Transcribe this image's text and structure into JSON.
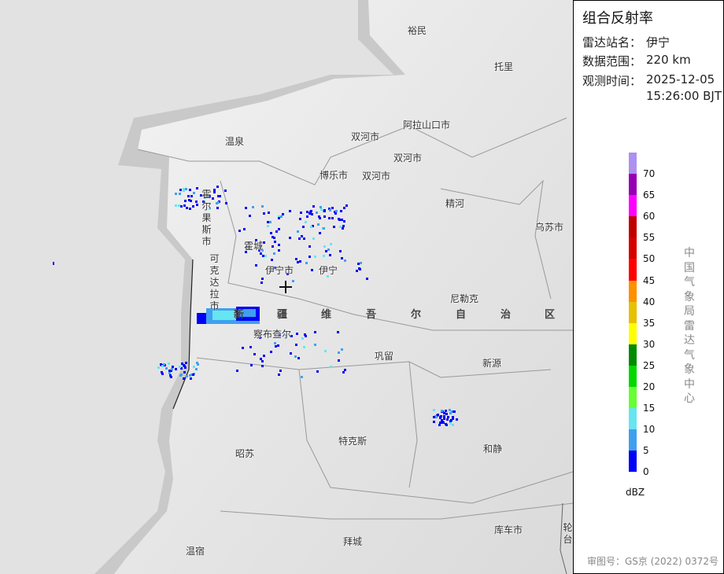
{
  "panel": {
    "title": "组合反射率",
    "station_label": "雷达站名：",
    "station": "伊宁",
    "range_label": "数据范围：",
    "range": "220 km",
    "time_label": "观测时间：",
    "date": "2025-12-05",
    "time": "15:26:00 BJT",
    "unit": "dBZ",
    "org": "中国气象局雷达气象中心",
    "approval": "审图号：GS京 (2022) 0372号"
  },
  "legend": {
    "ticks": [
      "70",
      "65",
      "60",
      "55",
      "50",
      "45",
      "40",
      "35",
      "30",
      "25",
      "20",
      "15",
      "10",
      "5",
      "0"
    ],
    "colors": [
      "#ad90f0",
      "#9600b4",
      "#ff00ff",
      "#c00000",
      "#d60000",
      "#ff0000",
      "#ff9000",
      "#e7c000",
      "#ffff00",
      "#008c00",
      "#00d800",
      "#66ff33",
      "#66e6f0",
      "#40a0f0",
      "#0000f6"
    ]
  },
  "map": {
    "cities": [
      "裕民",
      "托里",
      "温泉",
      "双河市",
      "阿拉山口市",
      "双河市",
      "博乐市",
      "双河市",
      "精河",
      "乌苏市",
      "霍城",
      "伊宁市",
      "伊宁",
      "尼勒克",
      "察布查尔",
      "巩留",
      "新源",
      "特克斯",
      "昭苏",
      "和静",
      "库车市",
      "温宿",
      "拜城"
    ],
    "vertical_cities": [
      "霍尔果斯市",
      "可克达拉市",
      "轮台"
    ],
    "region": [
      "新",
      "疆",
      "维",
      "吾",
      "尔",
      "自",
      "治",
      "区"
    ],
    "radar_site_icon": "crosshair-icon"
  }
}
